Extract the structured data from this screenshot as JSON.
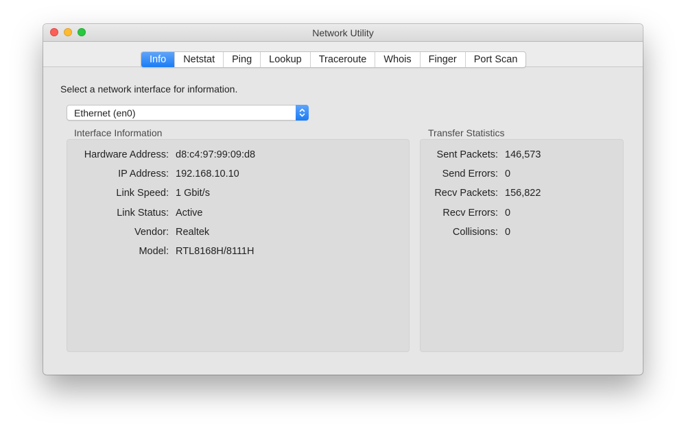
{
  "window": {
    "title": "Network Utility"
  },
  "tabs": [
    {
      "label": "Info",
      "active": true
    },
    {
      "label": "Netstat",
      "active": false
    },
    {
      "label": "Ping",
      "active": false
    },
    {
      "label": "Lookup",
      "active": false
    },
    {
      "label": "Traceroute",
      "active": false
    },
    {
      "label": "Whois",
      "active": false
    },
    {
      "label": "Finger",
      "active": false
    },
    {
      "label": "Port Scan",
      "active": false
    }
  ],
  "info": {
    "prompt": "Select a network interface for information.",
    "interface_select": {
      "value": "Ethernet (en0)"
    },
    "interface_information": {
      "title": "Interface Information",
      "rows": [
        {
          "label": "Hardware Address:",
          "value": "d8:c4:97:99:09:d8"
        },
        {
          "label": "IP Address:",
          "value": "192.168.10.10"
        },
        {
          "label": "Link Speed:",
          "value": "1 Gbit/s"
        },
        {
          "label": "Link Status:",
          "value": "Active"
        },
        {
          "label": "Vendor:",
          "value": "Realtek"
        },
        {
          "label": "Model:",
          "value": "RTL8168H/8111H"
        }
      ]
    },
    "transfer_statistics": {
      "title": "Transfer Statistics",
      "rows": [
        {
          "label": "Sent Packets:",
          "value": "146,573"
        },
        {
          "label": "Send Errors:",
          "value": "0"
        },
        {
          "label": "Recv Packets:",
          "value": "156,822"
        },
        {
          "label": "Recv Errors:",
          "value": "0"
        },
        {
          "label": "Collisions:",
          "value": "0"
        }
      ]
    }
  },
  "colors": {
    "accent": "#1a7cf5",
    "close": "#fc5f57",
    "minimize": "#fdbc2e",
    "zoom": "#28c840"
  }
}
